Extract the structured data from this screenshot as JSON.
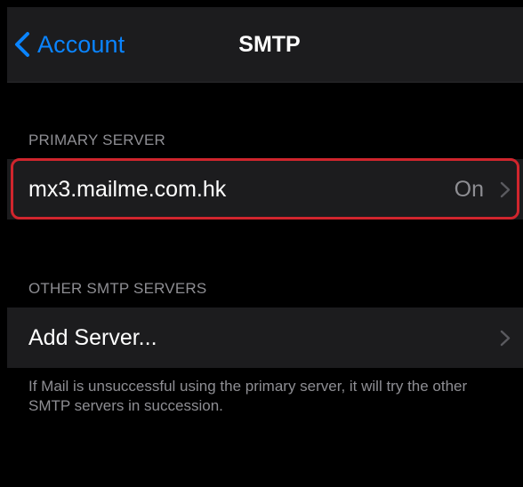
{
  "navbar": {
    "back_label": "Account",
    "back_icon": "chevron-left-icon",
    "title": "SMTP"
  },
  "primary_section": {
    "header": "PRIMARY SERVER",
    "server": {
      "name": "mx3.mailme.com.hk",
      "status": "On",
      "chevron_icon": "chevron-right-icon"
    }
  },
  "other_section": {
    "header": "OTHER SMTP SERVERS",
    "add_label": "Add Server...",
    "chevron_icon": "chevron-right-icon"
  },
  "footer": "If Mail is unsuccessful using the primary server, it will try the other SMTP servers in succession.",
  "colors": {
    "accent": "#0a84ff",
    "highlight": "#d0252d",
    "cell_background": "#1c1c1e",
    "secondary_text": "#8e8e93"
  }
}
